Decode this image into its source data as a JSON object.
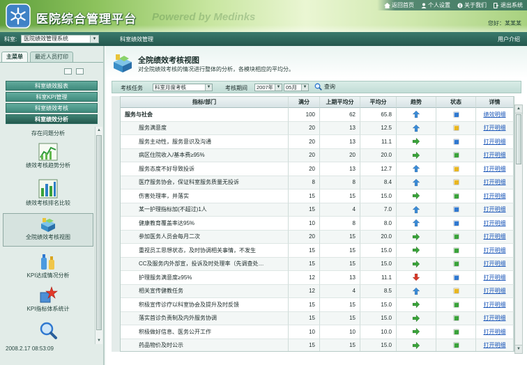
{
  "header": {
    "title": "医院综合管理平台",
    "watermark": "Powered by Medinks",
    "links": [
      {
        "label": "返回首页",
        "icon": "home-icon"
      },
      {
        "label": "个人设置",
        "icon": "user-icon"
      },
      {
        "label": "关于我们",
        "icon": "info-icon"
      },
      {
        "label": "退出系统",
        "icon": "exit-icon"
      }
    ],
    "greeting": "您好：某某某"
  },
  "navbar": {
    "dept_label": "科室:",
    "dept_select": "医院绩效管理系统",
    "breadcrumb": "科室绩效管理",
    "right_text": "用户介绍"
  },
  "sidebar": {
    "tabs": [
      {
        "label": "主菜单",
        "active": true
      },
      {
        "label": "最近人员打印",
        "active": false
      }
    ],
    "menu": [
      {
        "label": "科室绩效报表"
      },
      {
        "label": "科室KPI管理"
      },
      {
        "label": "科室绩效考核"
      },
      {
        "label": "科室绩效分析",
        "current": true
      }
    ],
    "items": [
      {
        "label": "存在问题分析",
        "icon": "document-icon"
      },
      {
        "label": "绩效考核趋势分析",
        "icon": "line-chart-icon"
      },
      {
        "label": "绩效考核排名比较",
        "icon": "bar-chart-icon"
      },
      {
        "label": "全院绩效考核视图",
        "icon": "overview-icon",
        "selected": true
      },
      {
        "label": "KPI达成情况分析",
        "icon": "bottles-icon"
      },
      {
        "label": "KPI指标体系统计",
        "icon": "star-icon"
      },
      {
        "label": "",
        "icon": "magnifier-icon"
      }
    ],
    "timestamp": "2008.2.17 08:53:09"
  },
  "main": {
    "title": "全院绩效考核视图",
    "subtitle": "对全院绩效考核的情况进行整体的分析，各模块相应的平均分。",
    "filter": {
      "task_label": "考核任务",
      "task_value": "科室月度考核",
      "period_label": "考核期间",
      "year_value": "2007年",
      "month_value": "05月",
      "search_label": "查询"
    },
    "table": {
      "columns": [
        "指标/部门",
        "满分",
        "上期平均分",
        "平均分",
        "趋势",
        "状态",
        "详情"
      ],
      "rows": [
        {
          "name": "服务与社会",
          "group": true,
          "full": "100",
          "prev": "62",
          "avg": "65.8",
          "trend": "up",
          "status": "blue",
          "detail": "绩效明细"
        },
        {
          "name": "服务满意度",
          "full": "20",
          "prev": "13",
          "avg": "12.5",
          "trend": "up",
          "status": "yellow",
          "detail": "打开明细"
        },
        {
          "name": "服务主动性，服务意识及沟通",
          "full": "20",
          "prev": "13",
          "avg": "11.1",
          "trend": "right",
          "status": "blue",
          "detail": "打开明细"
        },
        {
          "name": "病区住院收入/基本费≥95%",
          "full": "20",
          "prev": "20",
          "avg": "20.0",
          "trend": "right",
          "status": "green",
          "detail": "打开明细"
        },
        {
          "name": "服务态度不好导致投诉",
          "full": "20",
          "prev": "13",
          "avg": "12.7",
          "trend": "up",
          "status": "yellow",
          "detail": "打开明细"
        },
        {
          "name": "医疗服务协会，保证科室服务质量无投诉",
          "full": "8",
          "prev": "8",
          "avg": "8.4",
          "trend": "up",
          "status": "yellow",
          "detail": "打开明细"
        },
        {
          "name": "伤害处理率，并落实",
          "full": "15",
          "prev": "15",
          "avg": "15.0",
          "trend": "right",
          "status": "green",
          "detail": "打开明细"
        },
        {
          "name": "某一护理指标加(不超过)1人",
          "full": "15",
          "prev": "4",
          "avg": "7.0",
          "trend": "up",
          "status": "blue",
          "detail": "打开明细"
        },
        {
          "name": "健康教育覆盖率达95%",
          "full": "10",
          "prev": "8",
          "avg": "8.0",
          "trend": "up",
          "status": "blue",
          "detail": "打开明细"
        },
        {
          "name": "参加医务人员会每月二次",
          "full": "20",
          "prev": "15",
          "avg": "20.0",
          "trend": "right",
          "status": "green",
          "detail": "打开明细"
        },
        {
          "name": "重视员工思想状态，及时协调相关事情，不发生",
          "full": "15",
          "prev": "15",
          "avg": "15.0",
          "trend": "right",
          "status": "green",
          "detail": "打开明细"
        },
        {
          "name": "CC及服务内外部宣，投诉及时处理率（先调查处…",
          "full": "15",
          "prev": "15",
          "avg": "15.0",
          "trend": "right",
          "status": "green",
          "detail": "打开明细"
        },
        {
          "name": "护理服务满意度≥95%",
          "full": "12",
          "prev": "13",
          "avg": "11.1",
          "trend": "down",
          "status": "blue",
          "detail": "打开明细"
        },
        {
          "name": "相关宣传健教任务",
          "full": "12",
          "prev": "4",
          "avg": "8.5",
          "trend": "up",
          "status": "yellow",
          "detail": "打开明细"
        },
        {
          "name": "积极宣传诊疗以科室协会及提升及时反馈",
          "full": "15",
          "prev": "15",
          "avg": "15.0",
          "trend": "right",
          "status": "green",
          "detail": "打开明细"
        },
        {
          "name": "落实首诊负责制及内外服务协调",
          "full": "15",
          "prev": "15",
          "avg": "15.0",
          "trend": "right",
          "status": "green",
          "detail": "打开明细"
        },
        {
          "name": "积极做好信息、医务公开工作",
          "full": "10",
          "prev": "10",
          "avg": "10.0",
          "trend": "right",
          "status": "green",
          "detail": "打开明细"
        },
        {
          "name": "药品物价及时公示",
          "full": "15",
          "prev": "15",
          "avg": "15.0",
          "trend": "right",
          "status": "green",
          "detail": "打开明细"
        }
      ]
    }
  },
  "colors": {
    "trend_up": "#3b8bd6",
    "trend_right": "#3aa23a",
    "trend_down": "#d63a2a",
    "status_blue": "#2f78d0",
    "status_yellow": "#e8b620",
    "status_green": "#3aa23a",
    "nav_bg": "#2e6a5e",
    "menu_button": "#4f9a8c"
  }
}
